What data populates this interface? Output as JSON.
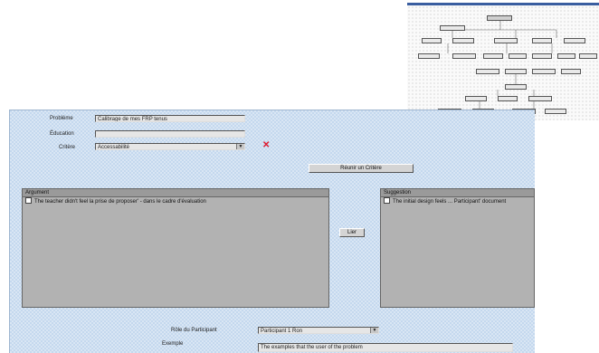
{
  "form": {
    "problem_label": "Problème",
    "problem_value": "Calibrage de mes FRP tenus",
    "education_label": "Éducation",
    "education_value": "",
    "criteria_label": "Critère",
    "criteria_value": "Accessabilité"
  },
  "buttons": {
    "top_button_label": "Réunir un Critère",
    "middle_button_label": "Lier"
  },
  "left_list": {
    "title": "Argument",
    "items": [
      "The teacher didn't feel la prise de proposer' - dans le cadre d'évaluation"
    ]
  },
  "right_list": {
    "title": "Suggestion",
    "items": [
      "The initial design feels ... Participant' document"
    ]
  },
  "bottom": {
    "participant_label": "Rôle du Participant",
    "participant_value": "Participant 1 Ron",
    "example_label": "Exemple",
    "example_value": "The examples that the user of the problem"
  },
  "colors": {
    "panel_bg": "#c4d8ee",
    "arrow": "#1d8a8f",
    "delete_x": "#e0182c",
    "chart_titlebar": "#3a5ea0"
  },
  "icons": [
    "delete-x-icon",
    "dropdown-arrow-icon",
    "checkbox-icon",
    "pointer-arrow-icon"
  ]
}
